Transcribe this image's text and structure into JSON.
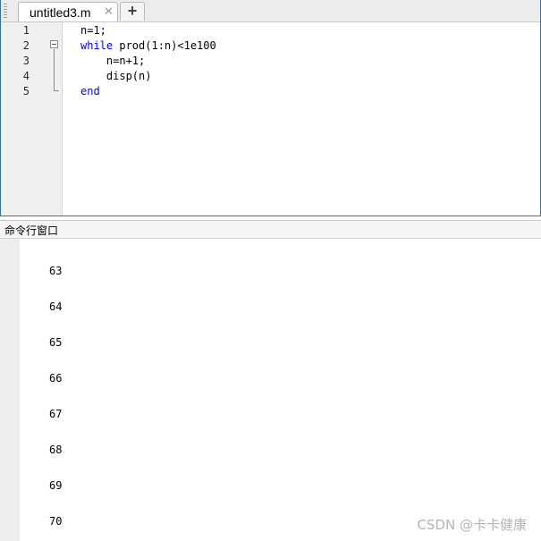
{
  "editor": {
    "tab_label": "untitled3.m",
    "tab_close_glyph": "✕",
    "add_tab_glyph": "+",
    "line_numbers": [
      "1",
      "2",
      "3",
      "4",
      "5"
    ],
    "code": {
      "line1": "n=1;",
      "line2_keyword": "while",
      "line2_rest": " prod(1:n)<1e100",
      "line3": "    n=n+1;",
      "line4": "    disp(n)",
      "line5_keyword": "end"
    },
    "keyword_color": "#0000ff"
  },
  "command_window": {
    "title": "命令行窗口",
    "output": [
      "63",
      "64",
      "65",
      "66",
      "67",
      "68",
      "69",
      "70"
    ]
  },
  "watermark": "CSDN @卡卡健康"
}
